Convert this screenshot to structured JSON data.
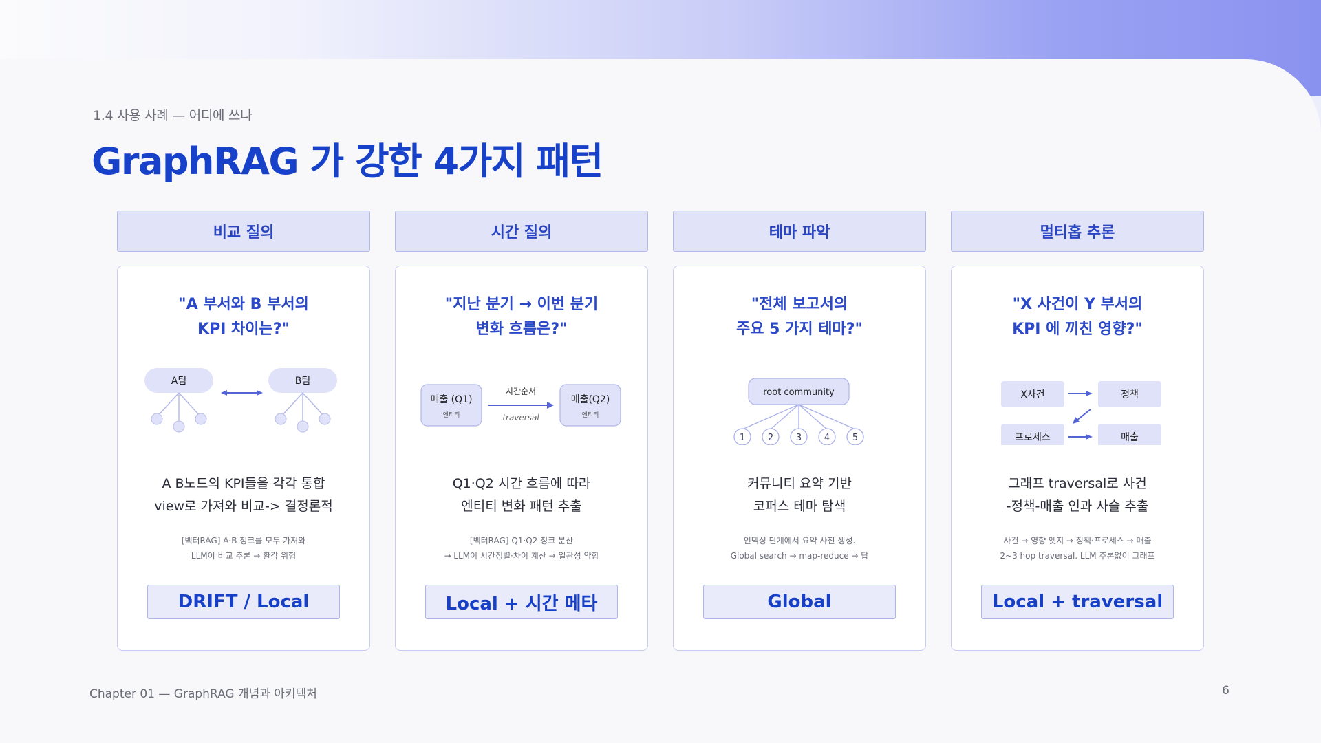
{
  "slide": {
    "section_label": "1.4 사용 사례 — 어디에 쓰나",
    "title": "GraphRAG 가 강한 4가지 패턴"
  },
  "columns": [
    {
      "header": "비교 질의",
      "question": [
        "\"A 부서와 B 부서의",
        "KPI 차이는?\""
      ],
      "diagram": {
        "left_node": "A팀",
        "right_node": "B팀"
      },
      "description": [
        "A B노드의 KPI들을 각각 통합",
        "view로 가져와 비교-> 결정론적"
      ],
      "note": [
        "[벡터RAG] A·B 청크를 모두 가져와",
        "LLM이 비교 추론 → 환각 위험"
      ],
      "badge": "DRIFT / Local"
    },
    {
      "header": "시간 질의",
      "question": [
        "\"지난 분기 → 이번 분기",
        "변화 흐름은?\""
      ],
      "diagram": {
        "left_box": "매출 (Q1)",
        "left_sub": "엔티티",
        "right_box": "매출(Q2)",
        "right_sub": "엔티티",
        "edge_top": "시간순서",
        "edge_bottom": "traversal"
      },
      "description": [
        "Q1·Q2 시간 흐름에 따라",
        "엔티티 변화 패턴 추출"
      ],
      "note": [
        "[벡터RAG] Q1·Q2 청크 분산",
        "→ LLM이 시간정렬·차이 계산 → 일관성 약함"
      ],
      "badge": "Local + 시간 메타"
    },
    {
      "header": "테마 파악",
      "question": [
        "\"전체 보고서의",
        "주요 5 가지 테마?\""
      ],
      "diagram": {
        "root": "root community",
        "children": [
          "1",
          "2",
          "3",
          "4",
          "5"
        ]
      },
      "description": [
        "커뮤니티 요약 기반",
        "코퍼스 테마 탐색"
      ],
      "note": [
        "인덱싱 단계에서 요약 사전 생성.",
        "Global search → map-reduce → 답"
      ],
      "badge": "Global"
    },
    {
      "header": "멀티홉 추론",
      "question": [
        "\"X 사건이 Y 부서의",
        "KPI 에 끼친 영향?\""
      ],
      "diagram": {
        "nodes": [
          "X사건",
          "정책",
          "프로세스",
          "매출"
        ]
      },
      "description": [
        "그래프 traversal로 사건",
        "-정책-매출 인과 사슬 추출"
      ],
      "note": [
        "사건 → 영향 엣지 → 정책·프로세스 → 매출",
        "2~3 hop traversal. LLM 추론없이 그래프"
      ],
      "badge": "Local + traversal"
    }
  ],
  "footer": {
    "chapter": "Chapter 01 — GraphRAG 개념과 아키텍처",
    "page_number": "6"
  },
  "colors": {
    "title_blue": "#1641c8",
    "header_fill": "#e1e3f8",
    "node_fill": "#dfe2f8",
    "line": "#aab0ea",
    "arrow": "#5264d6"
  }
}
